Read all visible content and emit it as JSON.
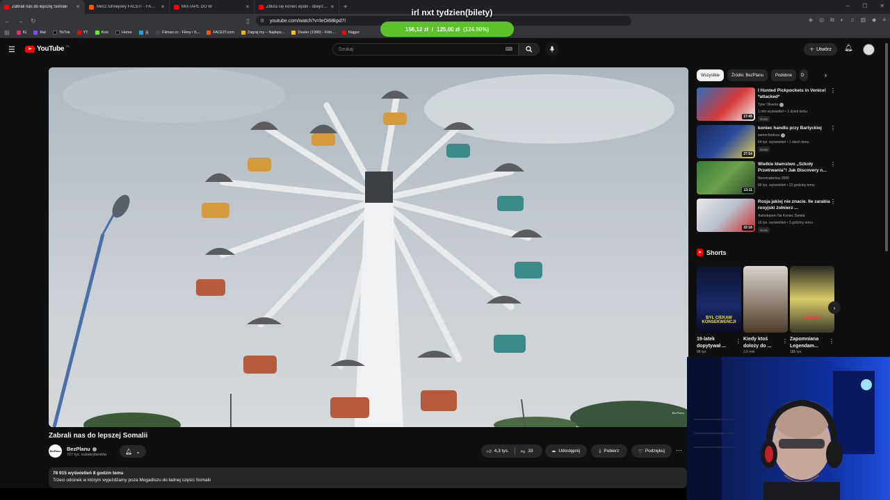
{
  "browser": {
    "tabs": [
      {
        "title": "Zabrali nas do lepszej Somalii",
        "active": true,
        "favicon_color": "#ff0000"
      },
      {
        "title": "Mecz turniejowy FACEIT - FACEIT",
        "active": false,
        "favicon_color": "#ff5500"
      },
      {
        "title": "MIXTAPE DO W",
        "active": false,
        "favicon_color": "#ff0000"
      },
      {
        "title": "Zbliża się koniec epoki - obejrzyj, by",
        "active": false,
        "favicon_color": "#ff0000"
      }
    ],
    "new_tab": "+",
    "url": "youtube.com/watch?v=leOi68kpd7I",
    "bookmarks": [
      {
        "label": "IG",
        "color": "#e1306c"
      },
      {
        "label": "Rat",
        "color": "#7b4dff"
      },
      {
        "label": "TikTok",
        "color": "#000000"
      },
      {
        "label": "YT",
        "color": "#ff0000"
      },
      {
        "label": "Kick",
        "color": "#53fc18"
      },
      {
        "label": "Home",
        "color": "#000000"
      },
      {
        "label": "天",
        "color": "#1da1f2"
      },
      {
        "label": "Filman.cc - Filmy i S...",
        "color": "#444444"
      },
      {
        "label": "FACEIT.com",
        "color": "#ff5500"
      },
      {
        "label": "Zagraj.my – Najleps...",
        "color": "#f5b400"
      },
      {
        "label": "Dealer (1996) - Film...",
        "color": "#f5c518"
      },
      {
        "label": "Najgor",
        "color": "#ff0000"
      }
    ]
  },
  "overlay": {
    "title": "irl nxt tydzien(bilety)",
    "current": "156,12 zł",
    "separator": "/",
    "goal": "125,00 zł",
    "percent": "(124.90%)"
  },
  "header": {
    "logo_word": "YouTube",
    "country_code": "PL",
    "search_placeholder": "Szukaj",
    "create_label": "Utwórz"
  },
  "video": {
    "title": "Zabrali nas do lepszej Somalii",
    "watermark": "BezPlanu",
    "channel_name": "BezPlanu",
    "channel_avatar_text": "BezPlanu",
    "subscribers": "727 tys. subskrybentów",
    "likes": "4,3 tys.",
    "dislikes": "33",
    "share_label": "Udostępnij",
    "download_label": "Pobierz",
    "thanks_label": "Podziękuj",
    "views_line": "78 915 wyświetleń  8 godzin temu",
    "description": "Trzeci odcinek w którym wyjeżdżamy poza Mogadiszu do ładnej części Somalii"
  },
  "chips": [
    "Wszystkie",
    "Źródło: BezPlanu",
    "Podobne",
    "D"
  ],
  "recommendations": [
    {
      "title": "I Hunted Pickpockets in Venice! *attacked*",
      "channel": "Tyler Oliveira",
      "verified": true,
      "meta": "1 mln wyświetleń • 1 dzień temu",
      "badge": "Nowy",
      "duration": "17:45"
    },
    {
      "title": "koniec handlu przy Bartyckiej",
      "channel": "samochodoza",
      "verified": true,
      "meta": "64 tys. wyświetleń • 1 dzień temu",
      "badge": "Nowy",
      "duration": "27:54"
    },
    {
      "title": "Wielkie kłamstwo „Szkoły Przetrwania”! Jak Discovery n...",
      "channel": "Neostradamus 2000",
      "verified": false,
      "meta": "86 tys. wyświetleń • 23 godziny temu",
      "badge": "",
      "duration": "13:11"
    },
    {
      "title": "Rosja jakiej nie znacie. Ile zarabia rosyjski żołnierz ...",
      "channel": "Autostopem Na Koniec Świata",
      "verified": false,
      "meta": "16 tys. wyświetleń • 3 godziny temu",
      "badge": "Nowy",
      "duration": "32:16"
    }
  ],
  "shorts": {
    "heading": "Shorts",
    "items": [
      {
        "title": "19-latek dopytywał ...",
        "views": "98 tys.",
        "thumb_text": "BYŁ CIEKAW KONSEKWENCJI"
      },
      {
        "title": "Kiedy ktoś dołoży do ...",
        "views": "2,6 mln",
        "thumb_text": ""
      },
      {
        "title": "Zapomniana Legendam...",
        "views": "186 tys.",
        "thumb_text": "JEDNAK"
      }
    ]
  },
  "colors": {
    "background": "#0f0f0f",
    "surface": "#272727",
    "brand_red": "#ff0000",
    "overlay_green": "#5bc22a"
  }
}
